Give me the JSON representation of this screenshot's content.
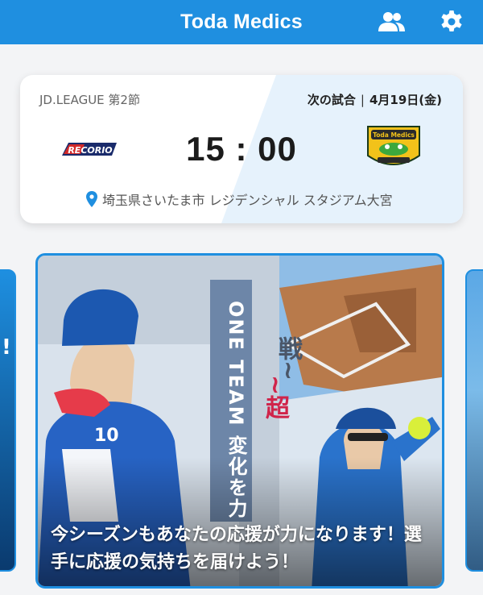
{
  "header": {
    "title": "Toda Medics",
    "icons": [
      "users-icon",
      "gear-icon"
    ]
  },
  "match": {
    "league": "JD.LEAGUE 第2節",
    "next_label": "次の試合",
    "separator": "|",
    "date": "4月19日(金)",
    "time": "15 : 00",
    "venue": "埼玉県さいたま市 レジデンシャル スタジアム大宮",
    "home_team_logo_text": "RECORIO",
    "away_team_logo_text": "Toda Medics"
  },
  "banner": {
    "slogan": "ONE TEAM 変化を力",
    "cho": "~超",
    "sen": "戦~",
    "player_number": "10",
    "caption": "今シーズンもあなたの応援が力になります！選手に応援の気持ちを届けよう！"
  },
  "side_left": {
    "text": "!"
  },
  "colors": {
    "primary": "#1f8fe0",
    "accent_red": "#d0244a"
  }
}
